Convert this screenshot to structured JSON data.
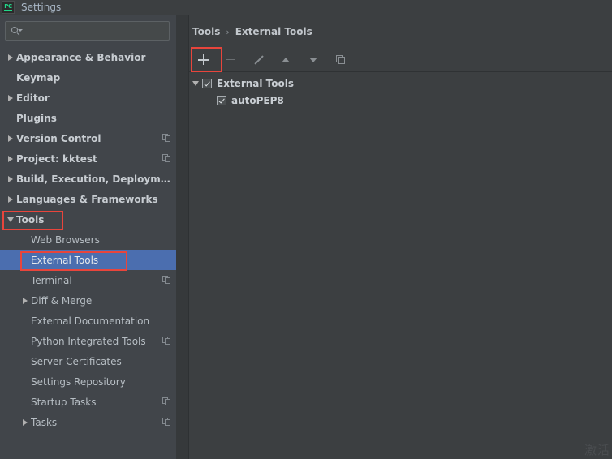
{
  "window": {
    "title": "Settings",
    "logo_text": "PC"
  },
  "colors": {
    "accent_selection": "#4b6eaf",
    "annotation_red": "#e8453c",
    "sidebar_bg": "#41454a",
    "panel_bg": "#3c3f41",
    "logo_green": "#21d789"
  },
  "search": {
    "value": "",
    "placeholder": ""
  },
  "sidebar": {
    "items": [
      {
        "label": "Appearance & Behavior",
        "level": 0,
        "arrow": "right",
        "bold": true,
        "badge": false,
        "selected": false
      },
      {
        "label": "Keymap",
        "level": 0,
        "arrow": "none",
        "bold": true,
        "badge": false,
        "selected": false
      },
      {
        "label": "Editor",
        "level": 0,
        "arrow": "right",
        "bold": true,
        "badge": false,
        "selected": false
      },
      {
        "label": "Plugins",
        "level": 0,
        "arrow": "none",
        "bold": true,
        "badge": false,
        "selected": false
      },
      {
        "label": "Version Control",
        "level": 0,
        "arrow": "right",
        "bold": true,
        "badge": true,
        "selected": false
      },
      {
        "label": "Project: kktest",
        "level": 0,
        "arrow": "right",
        "bold": true,
        "badge": true,
        "selected": false
      },
      {
        "label": "Build, Execution, Deployment",
        "level": 0,
        "arrow": "right",
        "bold": true,
        "badge": false,
        "selected": false
      },
      {
        "label": "Languages & Frameworks",
        "level": 0,
        "arrow": "right",
        "bold": true,
        "badge": false,
        "selected": false
      },
      {
        "label": "Tools",
        "level": 0,
        "arrow": "down",
        "bold": true,
        "badge": false,
        "selected": false
      },
      {
        "label": "Web Browsers",
        "level": 1,
        "arrow": "none",
        "bold": false,
        "badge": false,
        "selected": false
      },
      {
        "label": "External Tools",
        "level": 1,
        "arrow": "none",
        "bold": false,
        "badge": false,
        "selected": true
      },
      {
        "label": "Terminal",
        "level": 1,
        "arrow": "none",
        "bold": false,
        "badge": true,
        "selected": false
      },
      {
        "label": "Diff & Merge",
        "level": 1,
        "arrow": "right",
        "bold": false,
        "badge": false,
        "selected": false
      },
      {
        "label": "External Documentation",
        "level": 1,
        "arrow": "none",
        "bold": false,
        "badge": false,
        "selected": false
      },
      {
        "label": "Python Integrated Tools",
        "level": 1,
        "arrow": "none",
        "bold": false,
        "badge": true,
        "selected": false
      },
      {
        "label": "Server Certificates",
        "level": 1,
        "arrow": "none",
        "bold": false,
        "badge": false,
        "selected": false
      },
      {
        "label": "Settings Repository",
        "level": 1,
        "arrow": "none",
        "bold": false,
        "badge": false,
        "selected": false
      },
      {
        "label": "Startup Tasks",
        "level": 1,
        "arrow": "none",
        "bold": false,
        "badge": true,
        "selected": false
      },
      {
        "label": "Tasks",
        "level": 1,
        "arrow": "right",
        "bold": false,
        "badge": true,
        "selected": false
      }
    ]
  },
  "main": {
    "breadcrumb": {
      "parent": "Tools",
      "separator": "›",
      "current": "External Tools"
    },
    "toolbar": {
      "buttons": [
        {
          "name": "add-button",
          "icon": "plus-icon",
          "enabled": true,
          "highlighted": true
        },
        {
          "name": "remove-button",
          "icon": "minus-icon",
          "enabled": false,
          "highlighted": false
        },
        {
          "name": "edit-button",
          "icon": "pencil-icon",
          "enabled": false,
          "highlighted": false
        },
        {
          "name": "move-up-button",
          "icon": "arrow-up-icon",
          "enabled": false,
          "highlighted": false
        },
        {
          "name": "move-down-button",
          "icon": "arrow-down-icon",
          "enabled": false,
          "highlighted": false
        },
        {
          "name": "copy-button",
          "icon": "copy-icon",
          "enabled": false,
          "highlighted": false
        }
      ]
    },
    "tools_tree": {
      "group": {
        "label": "External Tools",
        "checked": true,
        "expanded": true
      },
      "children": [
        {
          "label": "autoPEP8",
          "checked": true
        }
      ]
    }
  },
  "watermark": {
    "text": "激活"
  }
}
